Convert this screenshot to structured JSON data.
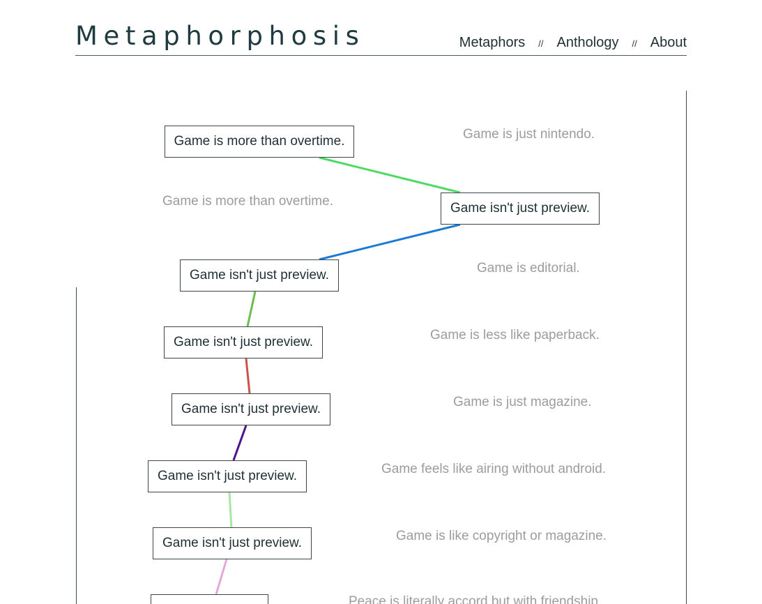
{
  "header": {
    "site_title": "Metaphorphosis",
    "nav": {
      "metaphors": "Metaphors",
      "anthology": "Anthology",
      "about": "About",
      "separator": "//"
    }
  },
  "chain": [
    {
      "metaphor": "Game is more than overtime.",
      "alternative": "Game is just nintendo.",
      "link_color": "#4cd964"
    },
    {
      "metaphor": "Game isn't just preview.",
      "alternative": "Game is more than overtime.",
      "link_color": "#1b7ad4"
    },
    {
      "metaphor": "Game isn't just preview.",
      "alternative": "Game is editorial.",
      "link_color": "#6bbf4e"
    },
    {
      "metaphor": "Game isn't just preview.",
      "alternative": "Game is less like paperback.",
      "link_color": "#c8544a"
    },
    {
      "metaphor": "Game isn't just preview.",
      "alternative": "Game is just magazine.",
      "link_color": "#4a148c"
    },
    {
      "metaphor": "Game isn't just preview.",
      "alternative": "Game feels like airing without android.",
      "link_color": "#a8e6a3"
    },
    {
      "metaphor": "Game isn't just preview.",
      "alternative": "Game is like copyright or magazine.",
      "link_color": "#e4a8d8"
    },
    {
      "metaphor": "",
      "alternative": "Peace is literally accord but with friendship."
    }
  ]
}
